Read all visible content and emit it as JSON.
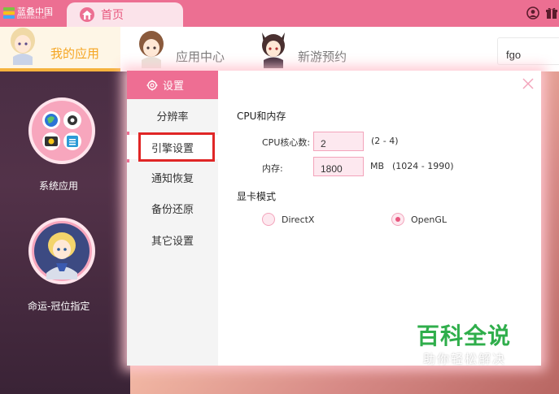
{
  "titlebar": {
    "logo_text": "蓝叠中国",
    "logo_subtext": "bluestacks.cn",
    "home_tab_label": "首页",
    "icons": [
      "user-circle-icon",
      "gift-icon"
    ]
  },
  "nav": {
    "tabs": [
      {
        "label": "我的应用",
        "active": true
      },
      {
        "label": "应用中心",
        "active": false
      },
      {
        "label": "新游预约",
        "active": false
      }
    ],
    "search_value": "fgo"
  },
  "apps": [
    {
      "label": "系统应用"
    },
    {
      "label": "命运-冠位指定"
    }
  ],
  "settings": {
    "title": "设置",
    "menu": [
      {
        "label": "分辨率",
        "active": false
      },
      {
        "label": "引擎设置",
        "active": true
      },
      {
        "label": "通知恢复",
        "active": false
      },
      {
        "label": "备份还原",
        "active": false
      },
      {
        "label": "其它设置",
        "active": false
      }
    ],
    "cpu_memory": {
      "section_title": "CPU和内存",
      "cpu_label": "CPU核心数:",
      "cpu_value": "2",
      "cpu_range": "(2 - 4)",
      "mem_label": "内存:",
      "mem_value": "1800",
      "mem_unit": "MB",
      "mem_range": "(1024 - 1990)"
    },
    "graphics": {
      "section_title": "显卡模式",
      "options": [
        {
          "label": "DirectX",
          "checked": false
        },
        {
          "label": "OpenGL",
          "checked": true
        }
      ]
    }
  },
  "watermark": {
    "main": "百科全说",
    "sub": "助你轻松解决"
  },
  "colors": {
    "accent_pink": "#ee6e93",
    "active_orange": "#f5a623",
    "highlight_red": "#e02626",
    "watermark_green": "#2fae4b"
  }
}
